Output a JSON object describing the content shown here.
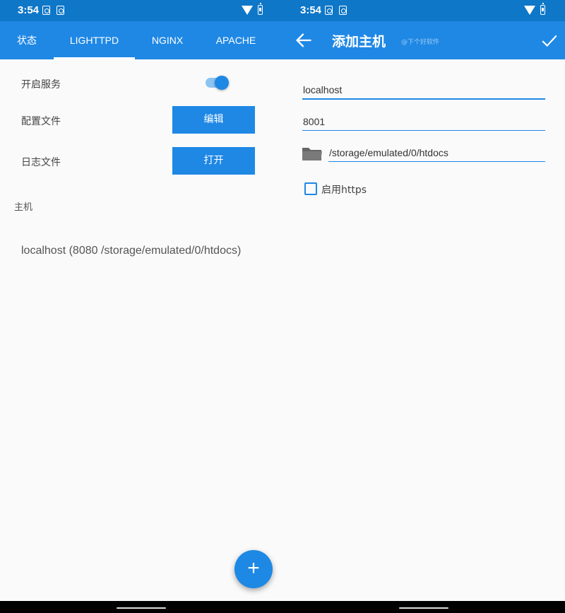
{
  "status": {
    "time": "3:54"
  },
  "left": {
    "tabs": [
      {
        "label": "状态"
      },
      {
        "label": "LIGHTTPD"
      },
      {
        "label": "NGINX"
      },
      {
        "label": "APACHE"
      }
    ],
    "active_tab": "LIGHTTPD",
    "settings": {
      "enable_label": "开启服务",
      "enabled": true,
      "config_label": "配置文件",
      "config_button": "编辑",
      "log_label": "日志文件",
      "log_button": "打开"
    },
    "host_section_label": "主机",
    "hosts": [
      {
        "text": "localhost (8080 /storage/emulated/0/htdocs)"
      }
    ],
    "fab_icon": "plus-icon",
    "fab_symbol": "+"
  },
  "right": {
    "title": "添加主机",
    "watermark": "@下个好软件",
    "back_icon": "arrow-left-icon",
    "confirm_icon": "check-icon",
    "host_value": "localhost",
    "port_value": "8001",
    "path_value": "/storage/emulated/0/htdocs",
    "folder_icon": "folder-icon",
    "https_label": "启用https",
    "https_checked": false
  },
  "colors": {
    "status_bar": "#0f77c8",
    "app_bar": "#1f88e5",
    "accent": "#1e88e5",
    "background": "#fafafa"
  }
}
